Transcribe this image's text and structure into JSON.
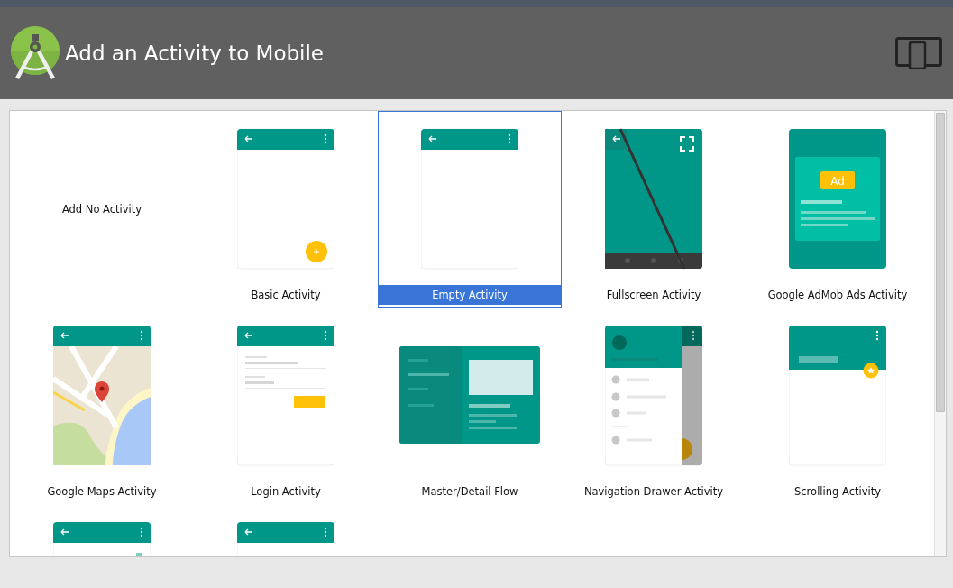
{
  "window": {
    "title": "Add an Activity to Mobile"
  },
  "activities": [
    {
      "kind": "none",
      "label": "Add No Activity",
      "selected": false
    },
    {
      "kind": "basic",
      "label": "Basic Activity",
      "selected": false
    },
    {
      "kind": "empty",
      "label": "Empty Activity",
      "selected": true
    },
    {
      "kind": "fullscreen",
      "label": "Fullscreen Activity",
      "selected": false
    },
    {
      "kind": "admob",
      "label": "Google AdMob Ads Activity",
      "selected": false,
      "badge": "Ad"
    },
    {
      "kind": "maps",
      "label": "Google Maps Activity",
      "selected": false
    },
    {
      "kind": "login",
      "label": "Login Activity",
      "selected": false
    },
    {
      "kind": "masterdetail",
      "label": "Master/Detail Flow",
      "selected": false
    },
    {
      "kind": "navdrawer",
      "label": "Navigation Drawer Activity",
      "selected": false
    },
    {
      "kind": "scrolling",
      "label": "Scrolling Activity",
      "selected": false
    },
    {
      "kind": "settings",
      "selected": false
    },
    {
      "kind": "empty",
      "selected": false
    }
  ]
}
